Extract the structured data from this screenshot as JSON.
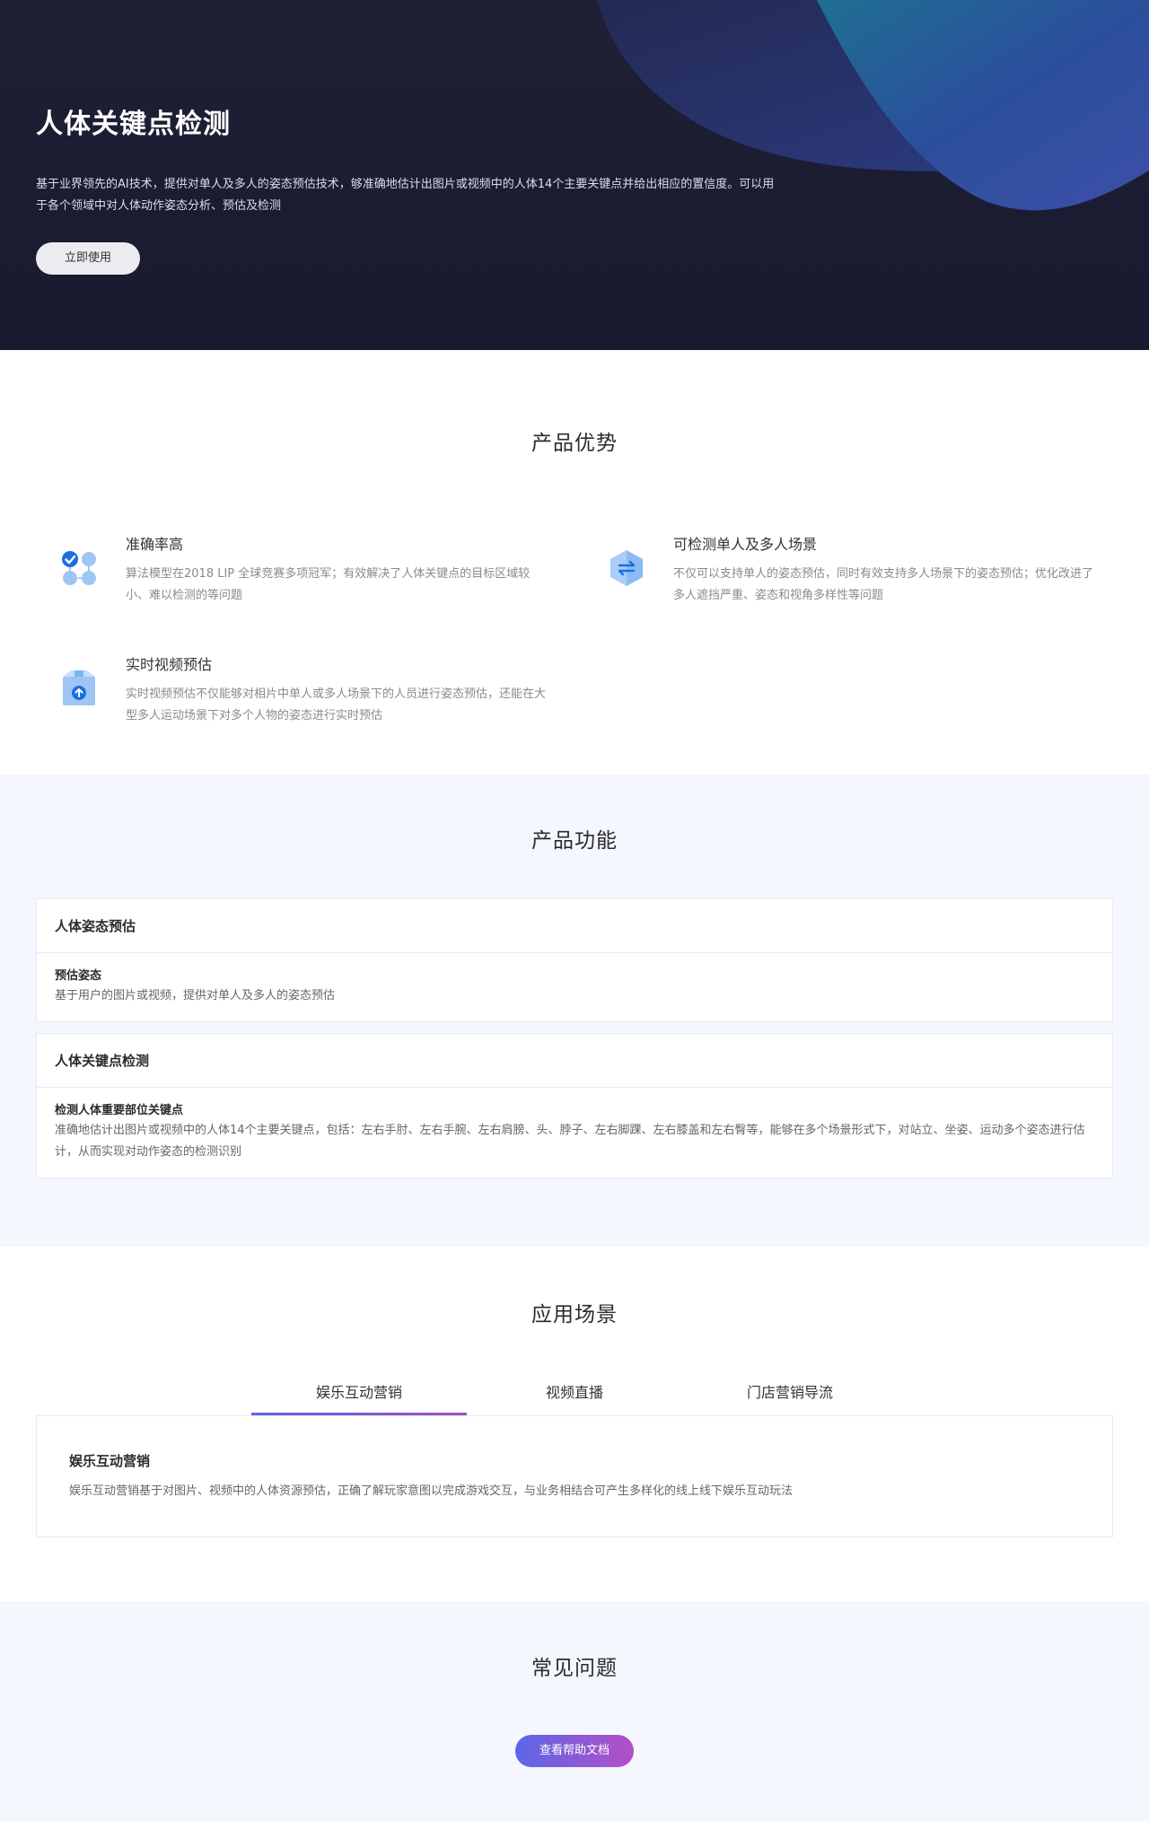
{
  "hero": {
    "title": "人体关键点检测",
    "description": "基于业界领先的AI技术，提供对单人及多人的姿态预估技术，够准确地估计出图片或视频中的人体14个主要关键点并给出相应的置信度。可以用于各个领域中对人体动作姿态分析、预估及检测",
    "cta_label": "立即使用"
  },
  "advantages": {
    "title": "产品优势",
    "items": [
      {
        "icon": "accuracy-icon",
        "title": "准确率高",
        "description": "算法模型在2018 LIP 全球竞赛多项冠军；有效解决了人体关键点的目标区域较小、难以检测的等问题"
      },
      {
        "icon": "switch-icon",
        "title": "可检测单人及多人场景",
        "description": "不仅可以支持单人的姿态预估，同时有效支持多人场景下的姿态预估；优化改进了多人遮挡严重、姿态和视角多样性等问题"
      },
      {
        "icon": "upload-box-icon",
        "title": "实时视频预估",
        "description": "实时视频预估不仅能够对相片中单人或多人场景下的人员进行姿态预估，还能在大型多人运动场景下对多个人物的姿态进行实时预估"
      }
    ]
  },
  "functions": {
    "title": "产品功能",
    "cards": [
      {
        "title": "人体姿态预估",
        "sub_title": "预估姿态",
        "text": "基于用户的图片或视频，提供对单人及多人的姿态预估"
      },
      {
        "title": "人体关键点检测",
        "sub_title": "检测人体重要部位关键点",
        "text": "准确地估计出图片或视频中的人体14个主要关键点，包括：左右手肘、左右手腕、左右肩膀、头、脖子、左右脚踝、左右膝盖和左右臀等，能够在多个场景形式下，对站立、坐姿、运动多个姿态进行估计，从而实现对动作姿态的检测识别"
      }
    ]
  },
  "scenarios": {
    "title": "应用场景",
    "tabs": [
      "娱乐互动营销",
      "视频直播",
      "门店营销导流"
    ],
    "active_tab": "娱乐互动营销",
    "active_content": {
      "title": "娱乐互动营销",
      "description": "娱乐互动营销基于对图片、视频中的人体资源预估，正确了解玩家意图以完成游戏交互，与业务相结合可产生多样化的线上线下娱乐互动玩法"
    }
  },
  "faq": {
    "title": "常见问题",
    "button_label": "查看帮助文档"
  },
  "colors": {
    "hero_bg": "#1c1c34",
    "accent_start": "#5c67e6",
    "accent_end": "#b44fc6",
    "section_alt_bg": "#f4f7fd"
  }
}
